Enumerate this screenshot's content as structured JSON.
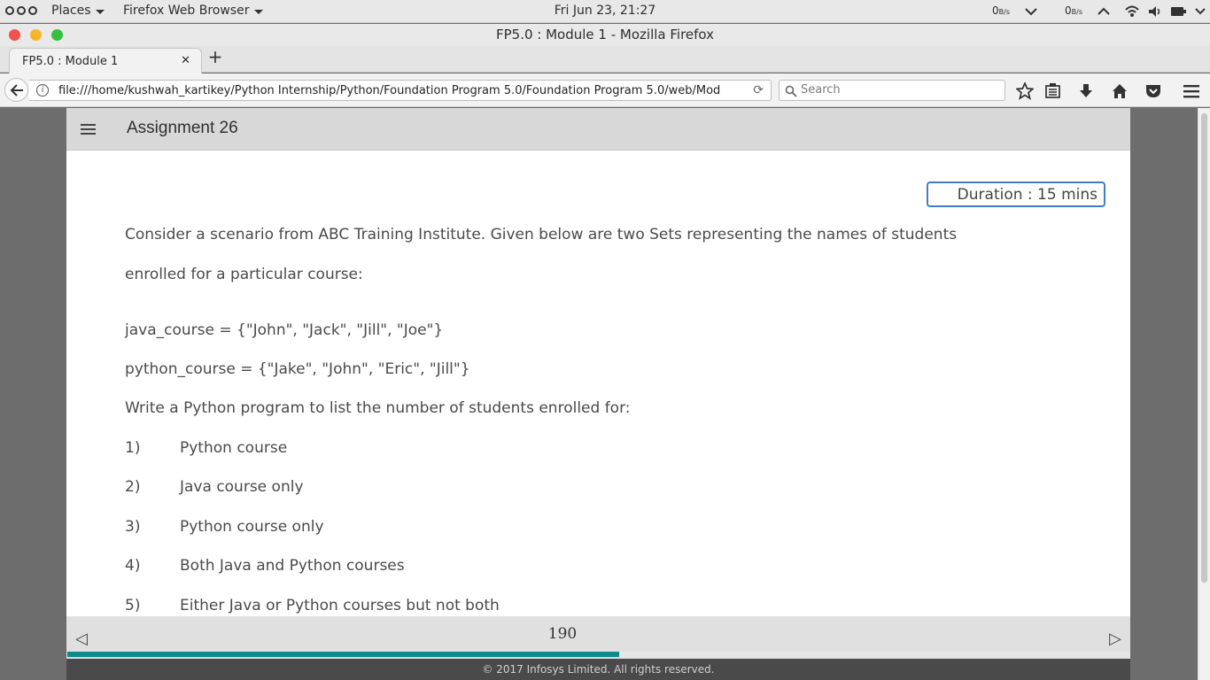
{
  "system_bar": {
    "places_label": "Places",
    "app_label": "Firefox Web Browser",
    "clock": "Fri Jun 23, 21:27",
    "net_down_value": "0",
    "net_down_unit": "B/s",
    "net_up_value": "0",
    "net_up_unit": "B/s"
  },
  "window": {
    "title": "FP5.0 : Module 1 - Mozilla Firefox",
    "close_color": "#f2524f",
    "minimize_color": "#f6b628",
    "maximize_color": "#35c13d"
  },
  "tabs": [
    {
      "label": "FP5.0 : Module 1",
      "active": true
    }
  ],
  "toolbar": {
    "url": "file:///home/kushwah_kartikey/Python Internship/Python/Foundation Program 5.0/Foundation Program 5.0/web/Mod",
    "search_placeholder": "Search",
    "icons": [
      "back-icon",
      "site-info-icon",
      "reload-icon",
      "search-icon",
      "bookmark-star-icon",
      "reading-list-icon",
      "download-icon",
      "home-icon",
      "pocket-icon",
      "menu-icon"
    ]
  },
  "page": {
    "header_title": "Assignment 26",
    "duration_label": "Duration : 15 mins",
    "intro_line1": "Consider a scenario from ABC Training Institute. Given below are two Sets representing the names of students",
    "intro_line2": "enrolled for a particular course:",
    "java_set": "java_course = {\"John\", \"Jack\", \"Jill\", \"Joe\"}",
    "python_set": "python_course = {\"Jake\", \"John\", \"Eric\", \"Jill\"}",
    "prompt": "Write a Python program to list the number of students enrolled for:",
    "items": [
      {
        "num": "1)",
        "text": "Python course"
      },
      {
        "num": "2)",
        "text": "Java course only"
      },
      {
        "num": "3)",
        "text": "Python course only"
      },
      {
        "num": "4)",
        "text": "Both Java and Python courses"
      },
      {
        "num": "5)",
        "text": "Either Java or Python courses but not both"
      }
    ],
    "page_number": "190",
    "progress_fraction": 0.52,
    "copyright": "© 2017 Infosys Limited. All rights reserved.",
    "accent_color": "#0d8a8a",
    "duration_border_color": "#3f7fbf"
  }
}
